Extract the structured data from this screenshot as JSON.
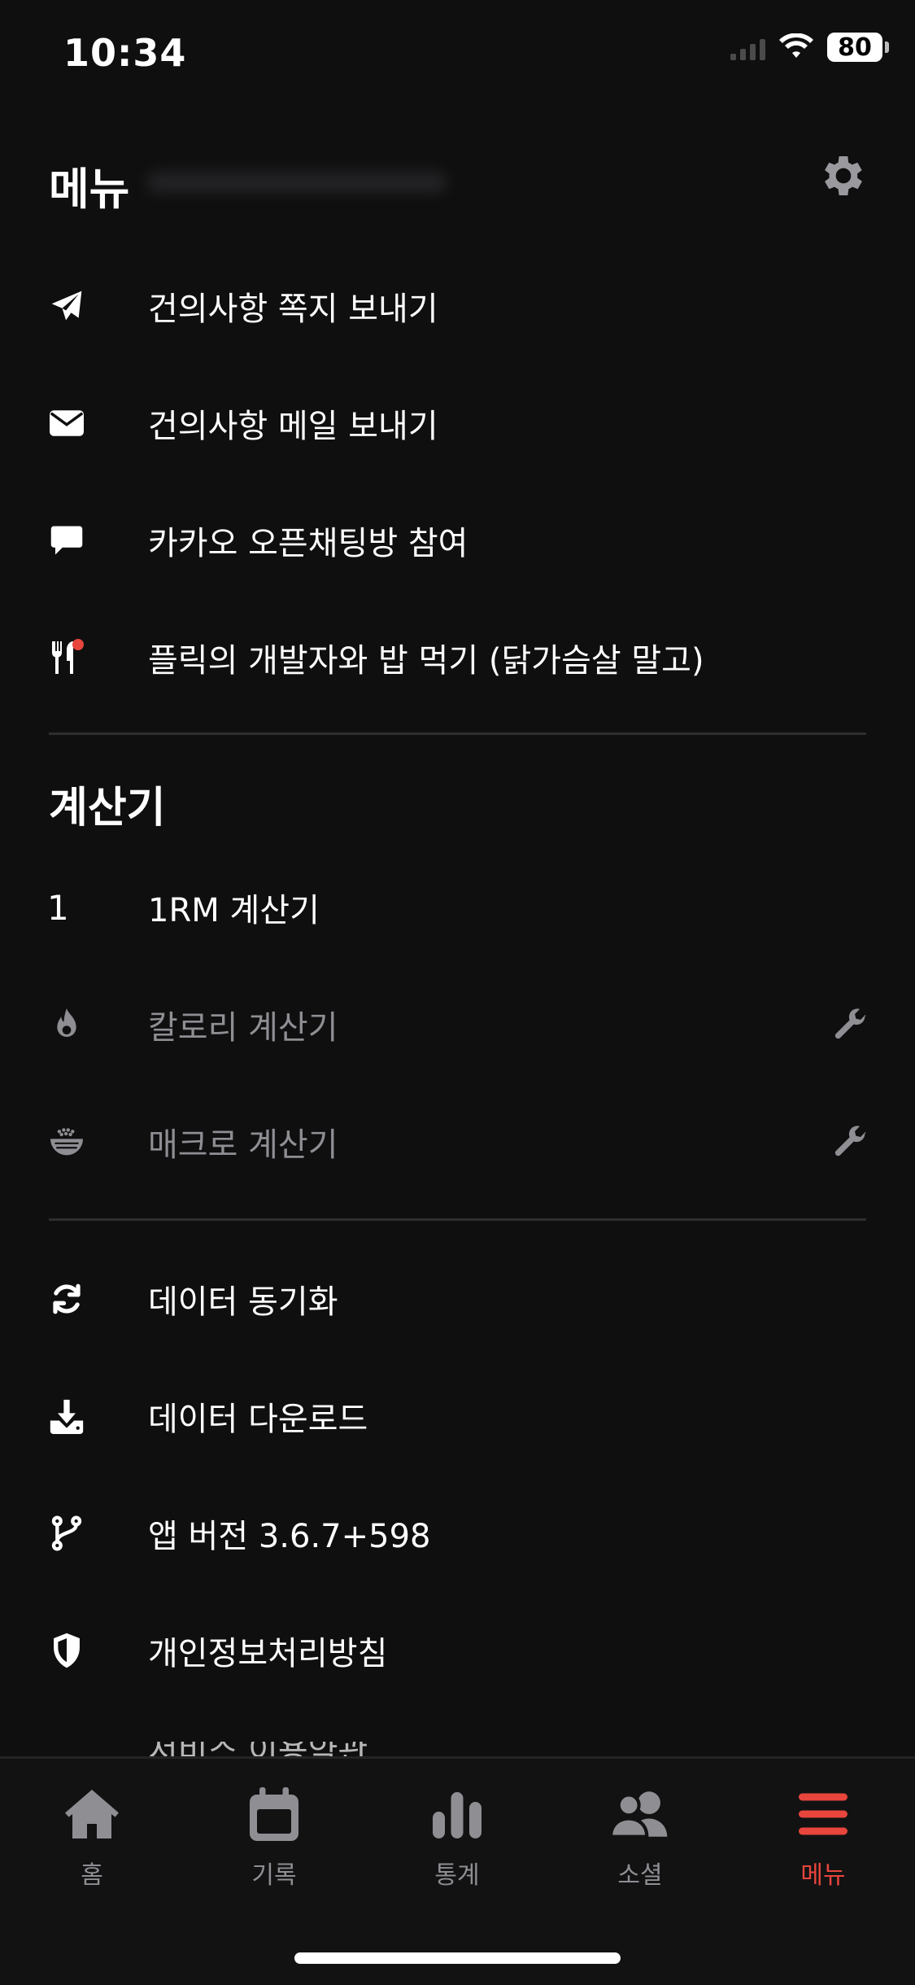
{
  "status": {
    "time": "10:34",
    "battery": "80"
  },
  "header": {
    "title": "메뉴",
    "settings_icon": "gear-icon"
  },
  "feedback_items": [
    {
      "label": "건의사항 쪽지 보내기",
      "icon": "paper-plane-icon"
    },
    {
      "label": "건의사항 메일 보내기",
      "icon": "envelope-icon"
    },
    {
      "label": "카카오 오픈채팅방 참여",
      "icon": "chat-bubble-icon"
    },
    {
      "label": "플릭의 개발자와 밥 먹기 (닭가슴살 말고)",
      "icon": "utensils-icon"
    }
  ],
  "calculators": {
    "title": "계산기",
    "items": [
      {
        "label": "1RM 계산기",
        "icon_text": "1"
      },
      {
        "label": "칼로리 계산기",
        "icon": "flame-icon",
        "disabled": true
      },
      {
        "label": "매크로 계산기",
        "icon": "rice-bowl-icon",
        "disabled": true
      }
    ]
  },
  "misc_items": [
    {
      "label": "데이터 동기화",
      "icon": "sync-icon"
    },
    {
      "label": "데이터 다운로드",
      "icon": "download-icon"
    },
    {
      "label": "앱 버전 3.6.7+598",
      "icon": "branch-icon"
    },
    {
      "label": "개인정보처리방침",
      "icon": "shield-icon"
    }
  ],
  "partial_item": {
    "label": "서비스 이용약관"
  },
  "tabs": [
    {
      "label": "홈",
      "icon": "home-icon"
    },
    {
      "label": "기록",
      "icon": "calendar-icon"
    },
    {
      "label": "통계",
      "icon": "bar-chart-icon"
    },
    {
      "label": "소셜",
      "icon": "users-icon"
    },
    {
      "label": "메뉴",
      "icon": "hamburger-icon",
      "active": true
    }
  ],
  "colors": {
    "background": "#0f0f10",
    "accent": "#e8453c",
    "muted": "#8e8e93",
    "divider": "#2e2e30"
  }
}
